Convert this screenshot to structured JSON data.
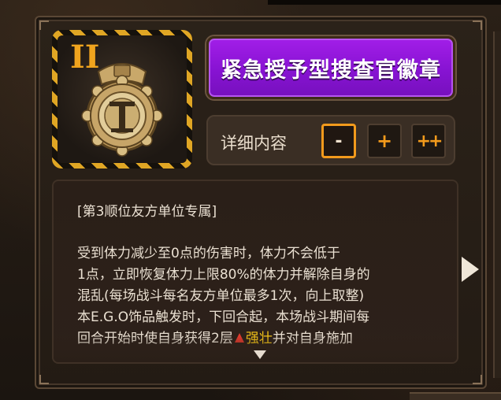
{
  "item": {
    "name": "紧急授予型搜查官徽章",
    "grade": "II",
    "icon": "investigator-badge-icon"
  },
  "detail_bar": {
    "label": "详细内容",
    "levels": [
      "-",
      "+",
      "++"
    ],
    "selected": "-"
  },
  "description": {
    "tag": "[第3顺位友方单位专属]",
    "body": "受到体力减少至0点的伤害时，体力不会低于\n1点，立即恢复体力上限80%的体力并解除自身的\n混乱(每场战斗每名友方单位最多1次，向上取整)\n本E.G.O饰品触发时，下回合起，本场战斗期间每\n回合开始时使自身获得2层",
    "keyword": "强壮",
    "tail": "并对自身施加"
  },
  "colors": {
    "title_bg": "#8a14d4",
    "accent_orange": "#f29a1c",
    "keyword_yellow": "#f5c518",
    "keyword_icon_red": "#e23b2e"
  },
  "icons": {
    "next": "next-arrow-icon",
    "scroll_down": "scroll-down-icon"
  }
}
